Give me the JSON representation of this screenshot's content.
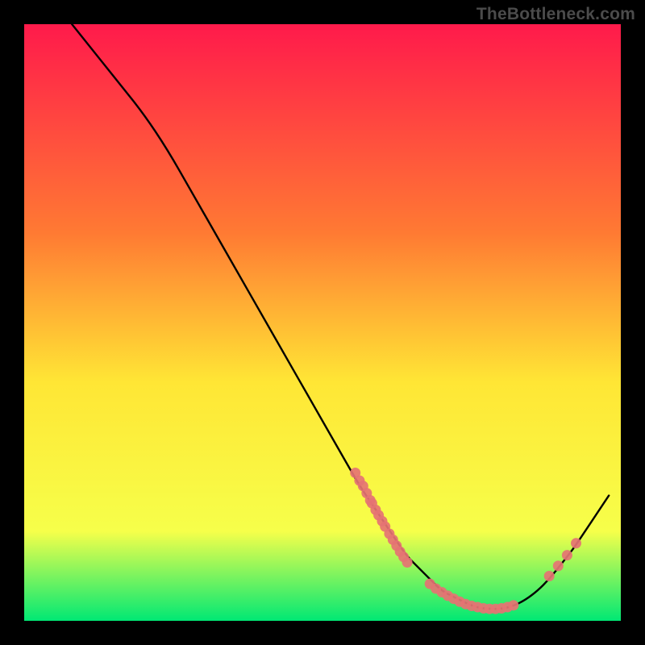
{
  "watermark": "TheBottleneck.com",
  "chart_data": {
    "type": "line",
    "title": "",
    "xlabel": "",
    "ylabel": "",
    "xlim": [
      0,
      100
    ],
    "ylim": [
      0,
      100
    ],
    "grid": false,
    "legend": false,
    "gradient_colors": {
      "top": "#ff1a4b",
      "mid_upper": "#ff7a33",
      "mid": "#ffe635",
      "mid_lower": "#f6ff4a",
      "bottom": "#00e874"
    },
    "series": [
      {
        "name": "curve",
        "type": "line",
        "color": "#000000",
        "x": [
          8,
          12,
          16,
          20,
          24,
          28,
          32,
          36,
          40,
          44,
          48,
          52,
          56,
          58,
          60,
          62,
          64,
          66,
          68,
          70,
          72,
          74,
          76,
          78,
          80,
          82,
          84,
          86,
          88,
          90,
          92,
          94,
          96,
          98
        ],
        "y": [
          100,
          95,
          90,
          85,
          79,
          72,
          65,
          58,
          51,
          44,
          37,
          30,
          23,
          20,
          17,
          14,
          11,
          9,
          7,
          5,
          4,
          3,
          2.2,
          2,
          2,
          2.5,
          3.5,
          5,
          7,
          9.5,
          12,
          15,
          18,
          21
        ]
      },
      {
        "name": "points-left-cluster",
        "type": "scatter",
        "color": "#e57373",
        "x": [
          55.5,
          56.2,
          56.8,
          57.4,
          58.0,
          58.3,
          58.9,
          59.4,
          60.0,
          60.5,
          61.2,
          61.8,
          62.4,
          63.0,
          63.6,
          64.2
        ],
        "y": [
          24.8,
          23.5,
          22.6,
          21.4,
          20.2,
          19.7,
          18.6,
          17.7,
          16.7,
          15.8,
          14.6,
          13.6,
          12.6,
          11.6,
          10.7,
          9.8
        ]
      },
      {
        "name": "points-bottom-cluster",
        "type": "scatter",
        "color": "#e57373",
        "x": [
          68,
          69,
          70,
          71,
          72,
          73,
          74,
          75,
          76,
          77,
          78,
          79,
          80,
          81,
          82
        ],
        "y": [
          6.2,
          5.4,
          4.8,
          4.2,
          3.7,
          3.2,
          2.8,
          2.5,
          2.3,
          2.1,
          2.0,
          2.0,
          2.1,
          2.3,
          2.6
        ]
      },
      {
        "name": "points-right-cluster",
        "type": "scatter",
        "color": "#e57373",
        "x": [
          88,
          89.5,
          91,
          92.5
        ],
        "y": [
          7.5,
          9.2,
          11.0,
          13.0
        ]
      }
    ]
  }
}
